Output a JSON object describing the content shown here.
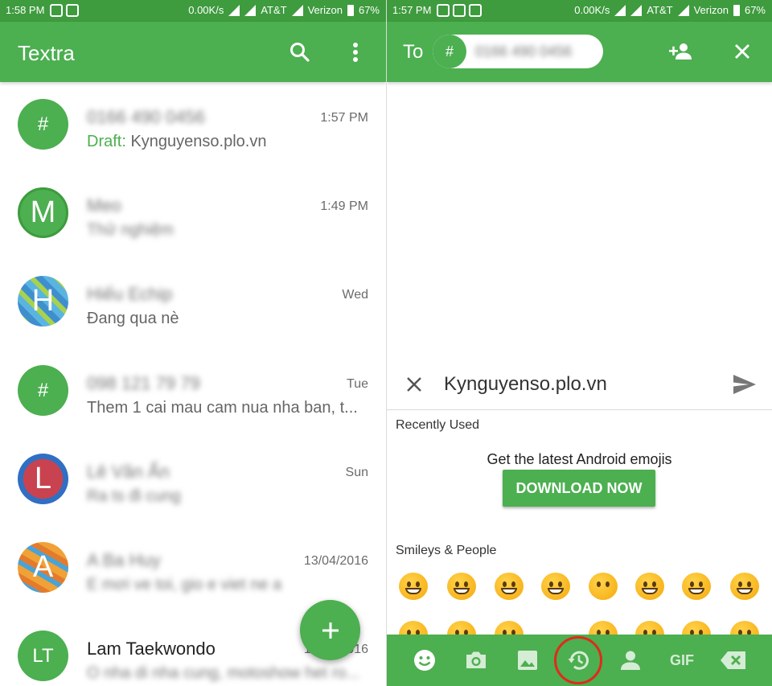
{
  "left": {
    "status": {
      "time": "1:58 PM",
      "net": "0.00K/s",
      "carrier1": "AT&T",
      "carrier2": "Verizon",
      "battery": "67%"
    },
    "app_title": "Textra",
    "conversations": [
      {
        "avatar": "#",
        "name": "0166 490 0456",
        "time": "1:57 PM",
        "draft_label": "Draft:",
        "preview": "Kynguyenso.plo.vn"
      },
      {
        "avatar": "M",
        "name": "Meo",
        "time": "1:49 PM",
        "preview": "Thử nghiệm"
      },
      {
        "avatar": "H",
        "name": "Hiếu Echip",
        "time": "Wed",
        "preview": "Đang qua nè"
      },
      {
        "avatar": "#",
        "name": "098 121 79 79",
        "time": "Tue",
        "preview": "Them 1 cai mau cam nua nha ban, t..."
      },
      {
        "avatar": "L",
        "name": "Lê Văn Ẩn",
        "time": "Sun",
        "preview": "Ra ts đi cung"
      },
      {
        "avatar": "A",
        "name": "A Ba Huy",
        "time": "13/04/2016",
        "preview": "E mơi ve toi, gio e viet ne a"
      },
      {
        "avatar": "LT",
        "name": "Lam Taekwondo",
        "time": "13/04/2016",
        "preview": "O nha di nha cung, motoshow het ro..."
      }
    ],
    "fab_icon": "plus-icon"
  },
  "right": {
    "status": {
      "time": "1:57 PM",
      "net": "0.00K/s",
      "carrier1": "AT&T",
      "carrier2": "Verizon",
      "battery": "67%"
    },
    "to_label": "To",
    "chip": {
      "hash": "#",
      "number": "0166 490 0456"
    },
    "message": "Kynguyenso.plo.vn",
    "recently_used": "Recently Used",
    "promo_text": "Get the latest Android emojis",
    "download_label": "DOWNLOAD NOW",
    "smileys_label": "Smileys & People",
    "bottom_tabs": [
      "smiley-icon",
      "camera-icon",
      "image-icon",
      "recent-icon",
      "contact-icon",
      "GIF",
      "backspace-icon"
    ]
  },
  "colors": {
    "accent": "#4caf50",
    "status": "#3e9b3e",
    "highlight": "#e02a1a"
  }
}
